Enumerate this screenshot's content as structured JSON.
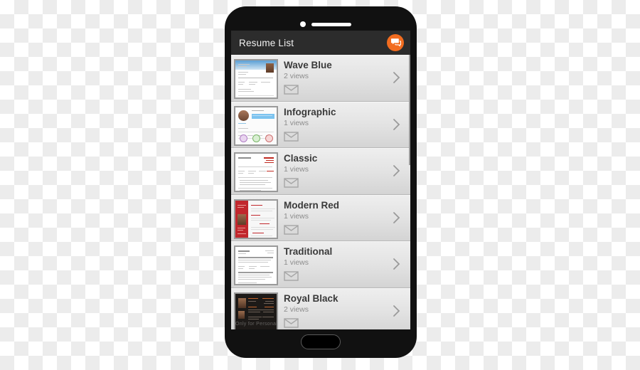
{
  "device": {
    "name": "smartphone-mockup",
    "camera": "camera-dot",
    "speaker": "speaker-grill",
    "home_button": "home-button"
  },
  "header": {
    "title": "Resume List",
    "chat_button_icon": "chat-bubble-icon",
    "accent_color": "#f26c1f",
    "background_color": "#2c2c2c",
    "text_color": "#f2f2f2"
  },
  "list": {
    "scrollbar": "vertical-scrollbar",
    "chevron_icon": "chevron-right-icon",
    "mail_icon": "envelope-icon",
    "items": [
      {
        "title": "Wave Blue",
        "views": "2 views",
        "thumb": "resume-thumb-wave-blue"
      },
      {
        "title": "Infographic",
        "views": "1 views",
        "thumb": "resume-thumb-infographic"
      },
      {
        "title": "Classic",
        "views": "1 views",
        "thumb": "resume-thumb-classic"
      },
      {
        "title": "Modern Red",
        "views": "1 views",
        "thumb": "resume-thumb-modern-red"
      },
      {
        "title": "Traditional",
        "views": "1 views",
        "thumb": "resume-thumb-traditional"
      },
      {
        "title": "Royal Black",
        "views": "2 views",
        "thumb": "resume-thumb-royal-black"
      }
    ]
  },
  "thumbnails": {
    "royal_black_watermark": "Only for Personal"
  }
}
